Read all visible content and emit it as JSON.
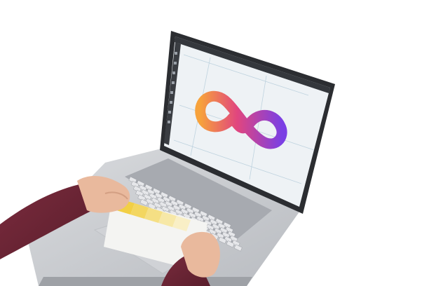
{
  "image": {
    "subject": "photo",
    "background_color": "#ffffff",
    "colors": {
      "laptop_body": "#c9cbcf",
      "laptop_dark": "#2b2d31",
      "screen_canvas": "#eef2f5",
      "toolbar": "#34373c",
      "sleeve": "#6e2637",
      "skin": "#e9b99d",
      "swatch_yellow": "#f2d44e",
      "logo_orange": "#f7a23b",
      "logo_pink": "#e1467e",
      "logo_purple": "#7b3fe4"
    },
    "icons": [
      "infinity-logo-icon"
    ]
  }
}
